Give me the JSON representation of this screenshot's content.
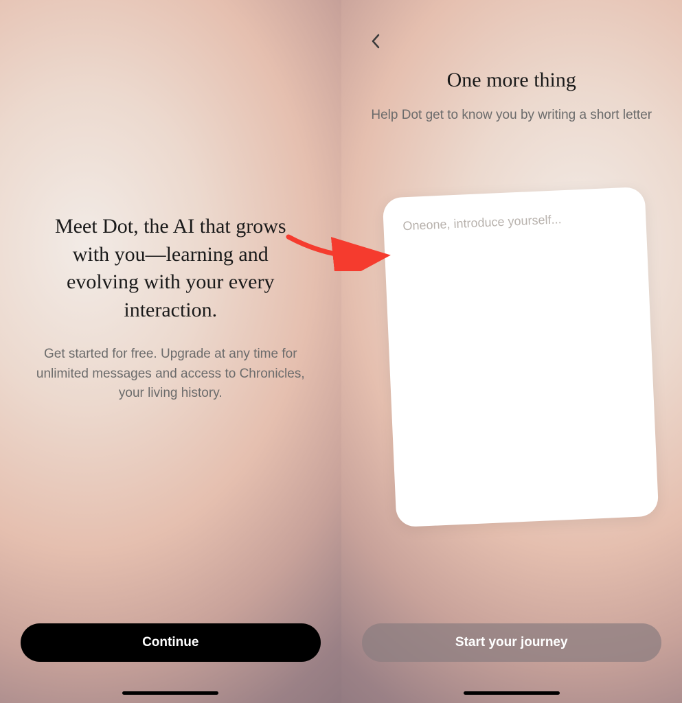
{
  "left": {
    "headline": "Meet Dot, the AI that grows with you—learning and evolving with your every interaction.",
    "subtext": "Get started for free. Upgrade at any time for unlimited messages and access to Chronicles, your living history.",
    "button_label": "Continue"
  },
  "right": {
    "title": "One more thing",
    "subtext": "Help Dot get to know you by writing a short letter",
    "placeholder": "Oneone, introduce yourself...",
    "button_label": "Start your journey"
  },
  "annotation": {
    "arrow_color": "#f53b2e"
  }
}
